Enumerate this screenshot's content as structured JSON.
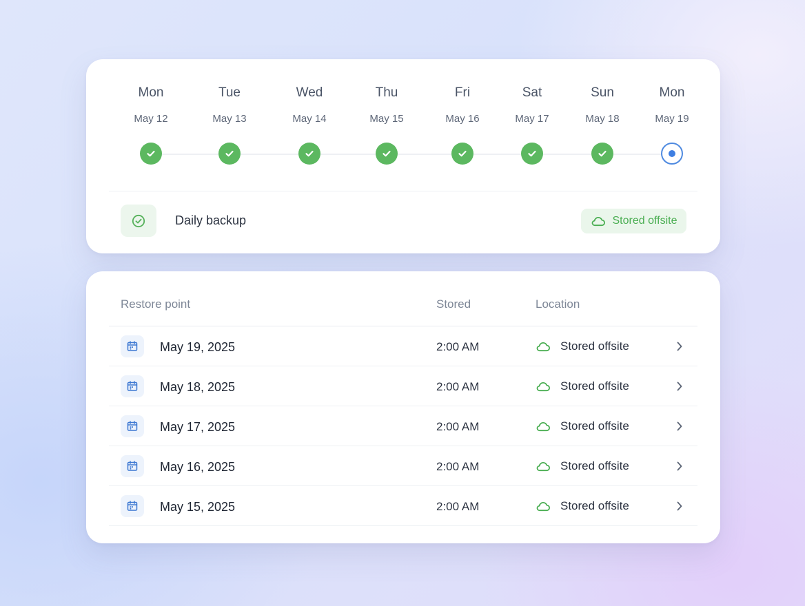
{
  "timeline": {
    "days": [
      {
        "name": "Mon",
        "date": "May 12",
        "status": "done"
      },
      {
        "name": "Tue",
        "date": "May 13",
        "status": "done"
      },
      {
        "name": "Wed",
        "date": "May 14",
        "status": "done"
      },
      {
        "name": "Thu",
        "date": "May 15",
        "status": "done"
      },
      {
        "name": "Fri",
        "date": "May 16",
        "status": "done"
      },
      {
        "name": "Sat",
        "date": "May 17",
        "status": "done"
      },
      {
        "name": "Sun",
        "date": "May 18",
        "status": "done"
      },
      {
        "name": "Mon",
        "date": "May 19",
        "status": "current"
      }
    ],
    "backup_label": "Daily backup",
    "badge_label": "Stored offsite"
  },
  "restore": {
    "headers": {
      "point": "Restore point",
      "stored": "Stored",
      "location": "Location"
    },
    "rows": [
      {
        "date": "May 19, 2025",
        "time": "2:00 AM",
        "location": "Stored offsite"
      },
      {
        "date": "May 18, 2025",
        "time": "2:00 AM",
        "location": "Stored offsite"
      },
      {
        "date": "May 17, 2025",
        "time": "2:00 AM",
        "location": "Stored offsite"
      },
      {
        "date": "May 16, 2025",
        "time": "2:00 AM",
        "location": "Stored offsite"
      },
      {
        "date": "May 15, 2025",
        "time": "2:00 AM",
        "location": "Stored offsite"
      }
    ]
  },
  "colors": {
    "success": "#5cb860",
    "accent_blue": "#3f7fe2",
    "badge_bg": "#eaf6eb"
  },
  "icons": {
    "done": "check-icon",
    "current": "current-dot-icon",
    "backup": "check-circle-icon",
    "cloud": "cloud-icon",
    "calendar": "calendar-icon",
    "chevron": "chevron-right-icon"
  }
}
